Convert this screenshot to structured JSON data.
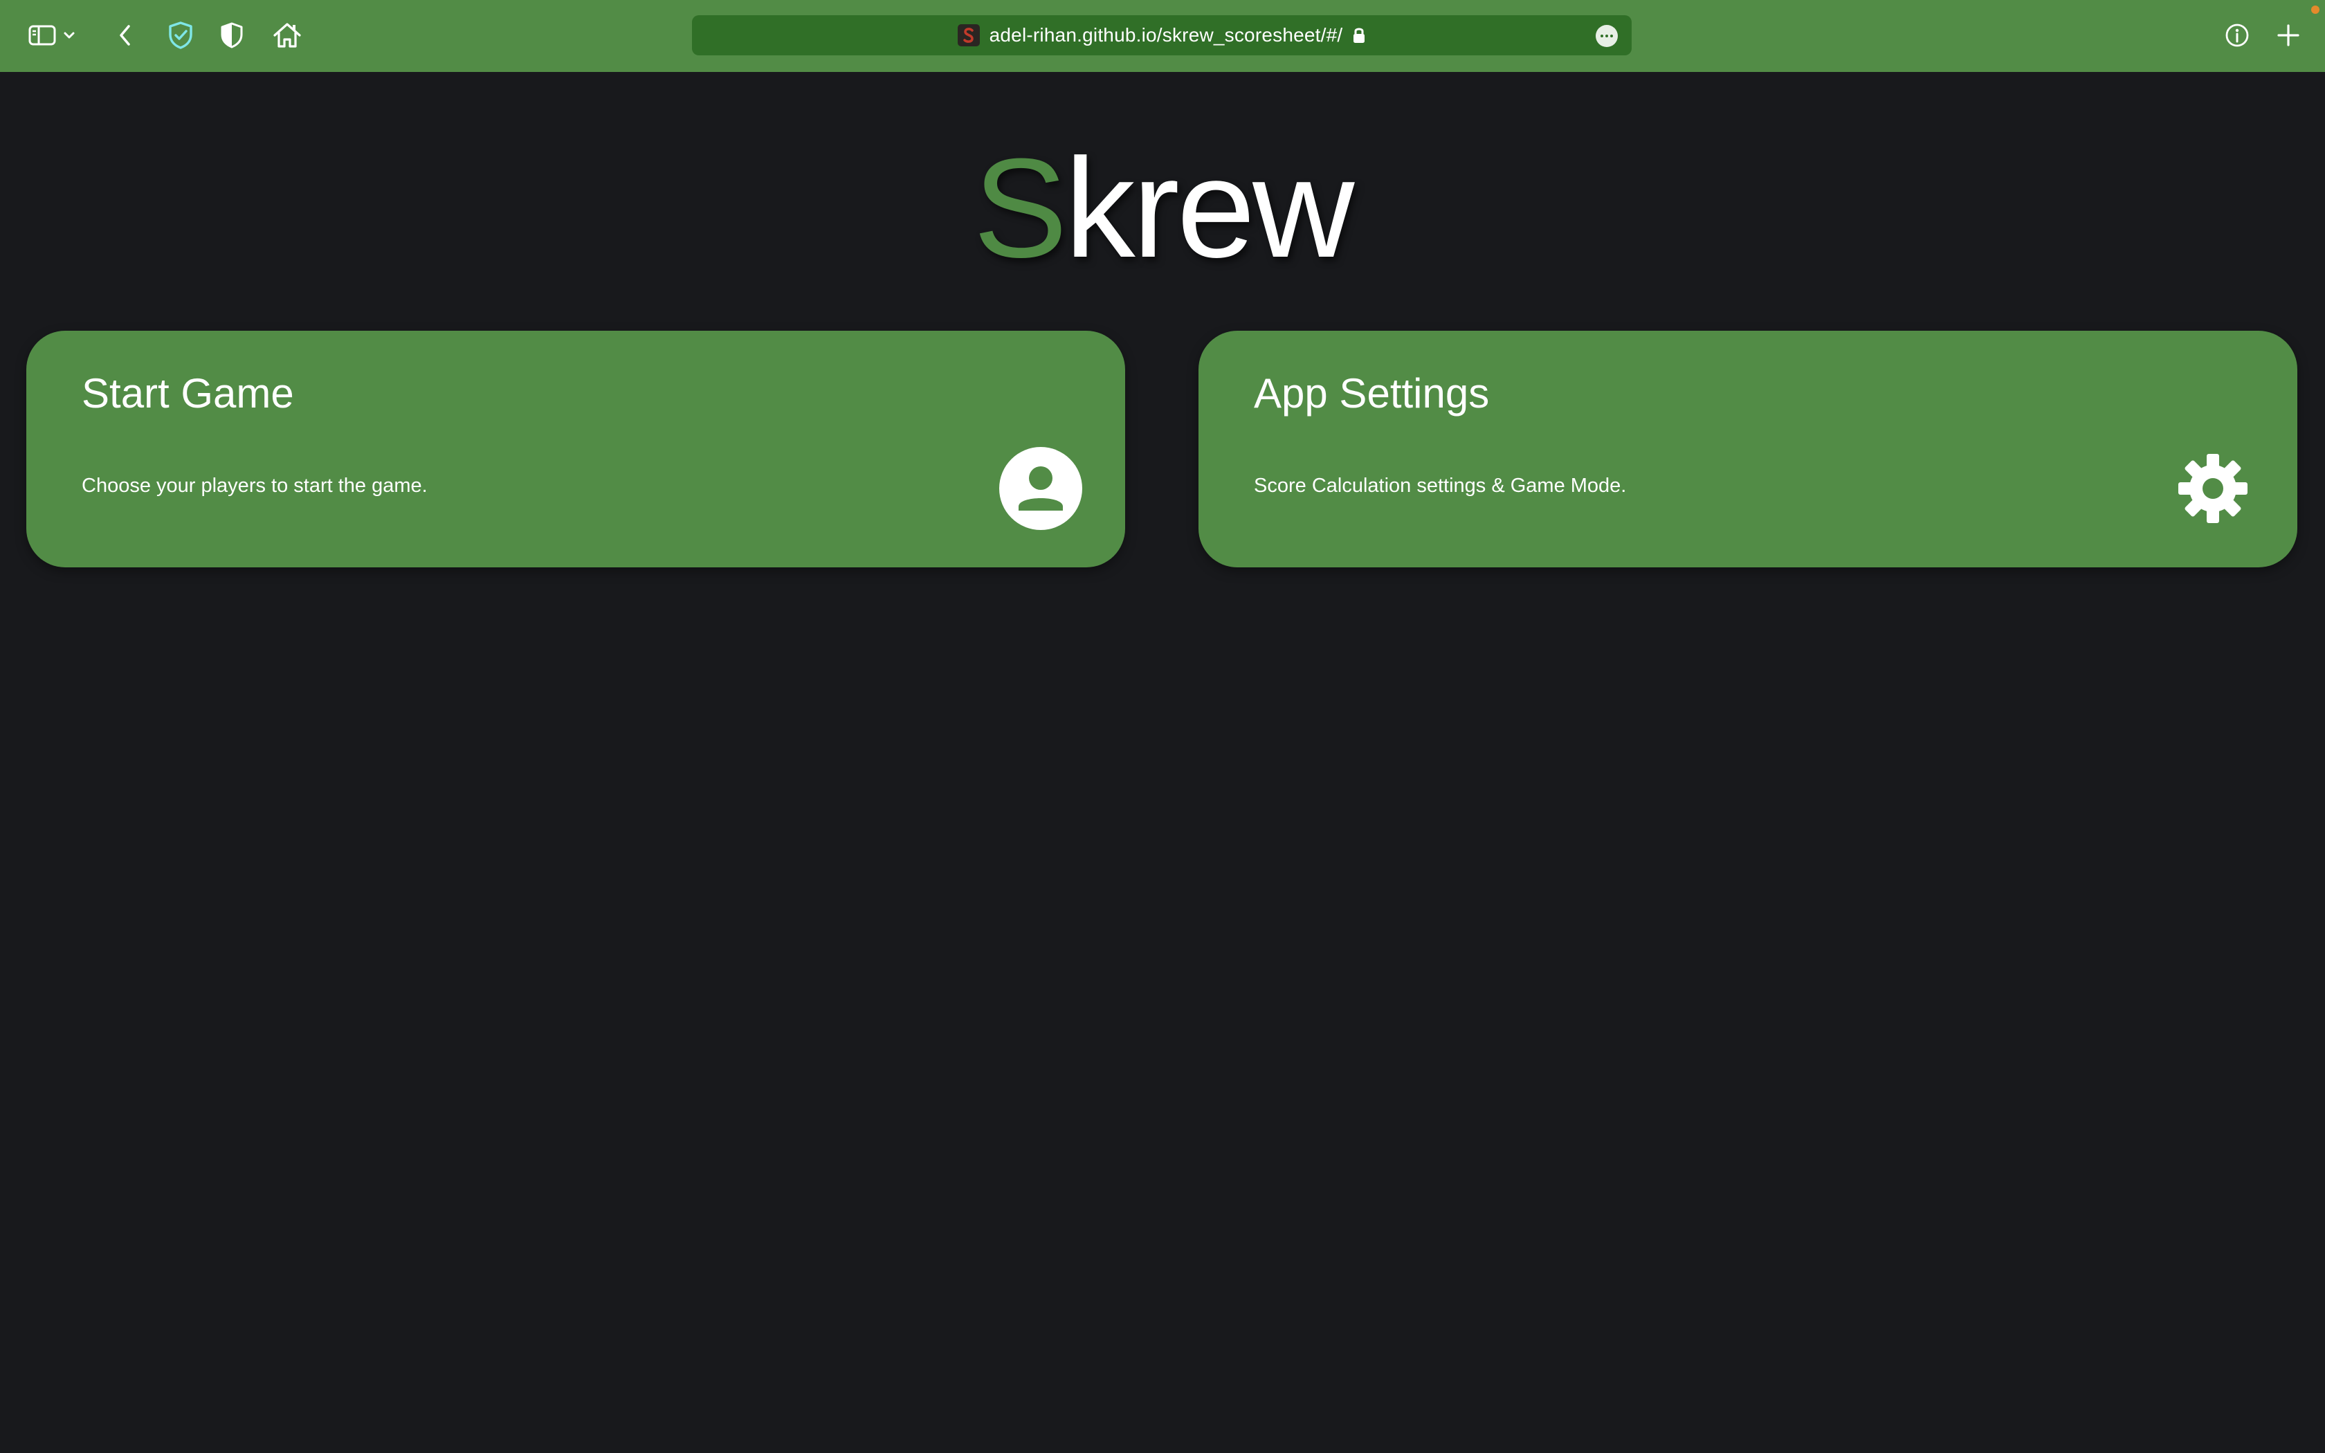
{
  "browser": {
    "url": "adel-rihan.github.io/skrew_scoresheet/#/",
    "icons": {
      "sidebar": "sidebar-icon",
      "sidebar_menu": "chevron-down-icon",
      "back": "chevron-left-icon",
      "privacy": "shield-check-icon",
      "shield": "half-shield-icon",
      "home": "home-icon",
      "lock": "lock-icon",
      "page_menu": "ellipsis-icon",
      "info": "info-icon",
      "new_tab": "plus-icon"
    },
    "toolbar_color": "#528c46",
    "urlbar_color": "#306f27"
  },
  "page": {
    "title_accent": "S",
    "title_rest": "krew",
    "accent_color": "#4f8a44",
    "background": "#18191c",
    "cards": [
      {
        "title": "Start Game",
        "description": "Choose your players to start the game.",
        "icon": "person-icon"
      },
      {
        "title": "App Settings",
        "description": "Score Calculation settings & Game Mode.",
        "icon": "gear-icon"
      }
    ],
    "card_color": "#528c46"
  }
}
